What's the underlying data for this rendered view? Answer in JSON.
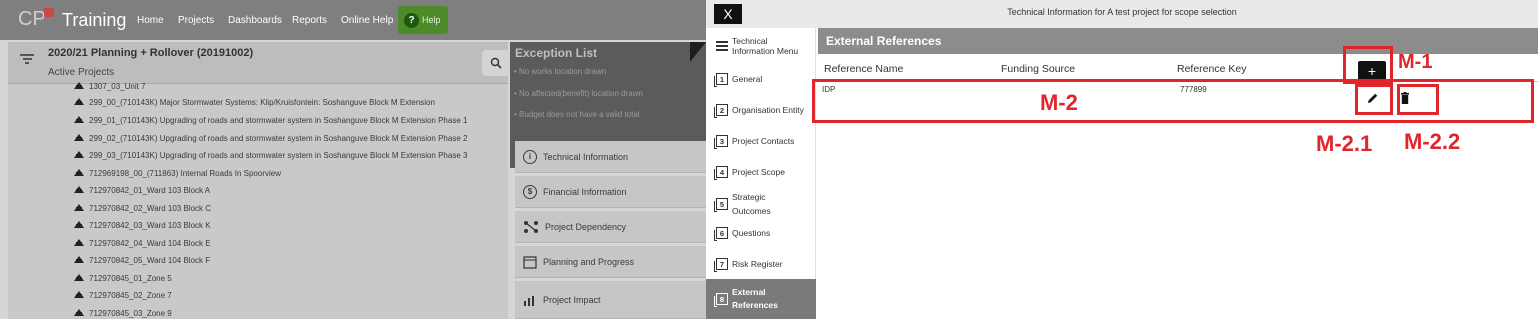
{
  "app": {
    "logo_text": "CP",
    "name": "Training",
    "nav": [
      "Home",
      "Projects",
      "Dashboards",
      "Reports",
      "Online Help"
    ],
    "help_label": "Help"
  },
  "project_panel": {
    "title": "2020/21 Planning + Rollover (20191002)",
    "subtitle": "Active Projects",
    "projects": [
      "1307_03_Unit 7",
      "299_00_(710143K) Major Stormwater Systems: Klip/Kruisfontein: Soshanguve Block M Extension",
      "299_01_(710143K) Upgrading of roads and stormwater system in Soshanguve Block M Extension Phase 1",
      "299_02_(710143K) Upgrading of roads and stormwater system in Soshanguve Block M Extension Phase 2",
      "299_03_(710143K) Upgrading of roads and stormwater system in Soshanguve Block M Extension Phase 3",
      "712969198_00_(711863) Internal Roads In Spoorview",
      "712970842_01_Ward 103 Block A",
      "712970842_02_Ward 103 Block C",
      "712970842_03_Ward 103 Block K",
      "712970842_04_Ward 104 Block E",
      "712970842_05_Ward 104 Block F",
      "712970845_01_Zone 5",
      "712970845_02_Zone 7",
      "712970845_03_Zone 9"
    ]
  },
  "exception_list": {
    "title": "Exception List",
    "items": [
      "No works location drawn",
      "No affected(benefit) location drawn",
      "Budget does not have a valid total"
    ]
  },
  "detail_menu": [
    "Technical Information",
    "Financial Information",
    "Project Dependency",
    "Planning and Progress",
    "Project Impact"
  ],
  "modal": {
    "close_label": "X",
    "title": "Technical Information for A test project for scope selection",
    "sidenav": [
      {
        "label": "Technical Information Menu",
        "num": ""
      },
      {
        "label": "General",
        "num": "1"
      },
      {
        "label": "Organisation Entity",
        "num": "2"
      },
      {
        "label": "Project Contacts",
        "num": "3"
      },
      {
        "label": "Project Scope",
        "num": "4"
      },
      {
        "label": "Strategic Outcomes",
        "num": "5"
      },
      {
        "label": "Questions",
        "num": "6"
      },
      {
        "label": "Risk Register",
        "num": "7"
      },
      {
        "label": "External References",
        "num": "8"
      }
    ],
    "section_title": "External References",
    "columns": [
      "Reference Name",
      "Funding Source",
      "Reference Key"
    ],
    "add_label": "+",
    "rows": [
      {
        "reference_name": "IDP",
        "funding_source": "",
        "reference_key": "777899"
      }
    ]
  },
  "annotations": [
    "M-1",
    "M-2",
    "M-2.1",
    "M-2.2"
  ],
  "colors": {
    "annotation": "#e0252c",
    "help_green": "#4c8a2a"
  }
}
